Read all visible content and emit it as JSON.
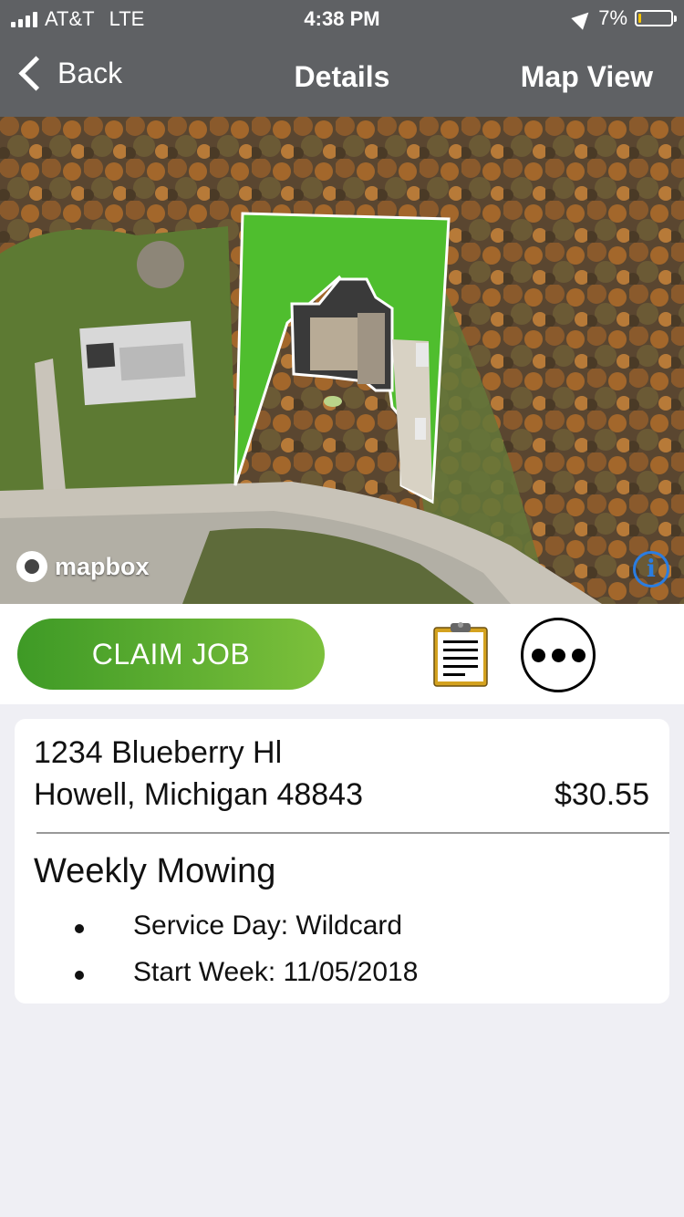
{
  "status_bar": {
    "carrier": "AT&T",
    "network": "LTE",
    "time": "4:38 PM",
    "battery_percent": "7%",
    "battery_level": 0.07
  },
  "nav": {
    "back_label": "Back",
    "title": "Details",
    "right_label": "Map View"
  },
  "map": {
    "attribution": "mapbox",
    "info_symbol": "i",
    "property_color": "#4fbe2e"
  },
  "actions": {
    "claim_label": "CLAIM JOB",
    "notes_icon": "clipboard-icon",
    "more_icon": "more-options-icon",
    "claim_color": "#5aaf2f"
  },
  "job": {
    "address_line1": "1234 Blueberry Hl",
    "address_line2": "Howell, Michigan 48843",
    "price": "$30.55",
    "service": "Weekly Mowing",
    "details": [
      "Service Day: Wildcard",
      "Start Week: 11/05/2018"
    ]
  }
}
